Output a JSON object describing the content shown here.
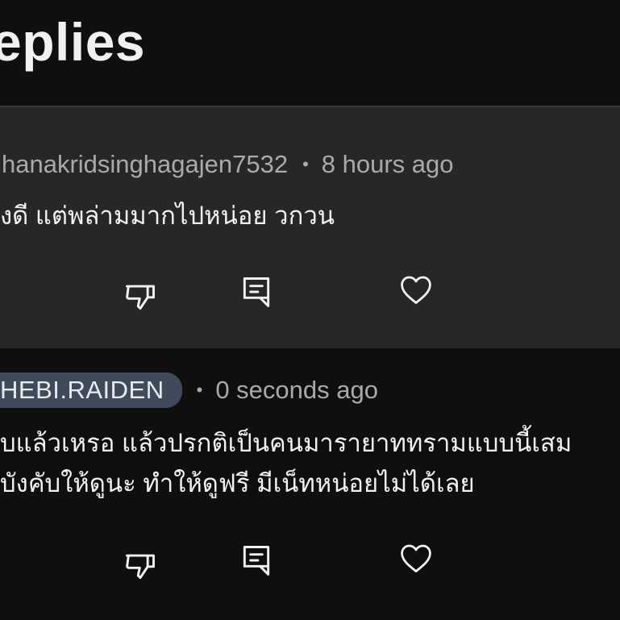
{
  "header": {
    "title": "eplies"
  },
  "comments": [
    {
      "author": "hanakridsinghagajen7532",
      "separator": "•",
      "timestamp": "8 hours ago",
      "lines": [
        "งดี แต่พล่ามมากไปหน่อย วกวน"
      ],
      "highlighted": true,
      "author_badge": false
    },
    {
      "author": "HEBI.RAIDEN",
      "separator": "•",
      "timestamp": "0 seconds ago",
      "lines": [
        "บแล้วเหรอ แล้วปรกติเป็นคนมารายาททรามแบบนี้เสม",
        "บังคับให้ดูนะ ทำให้ดูฟรี มีเน็ทหน่อยไม่ได้เลย"
      ],
      "highlighted": false,
      "author_badge": true
    }
  ],
  "icons": {
    "dislike": "thumbs-down-icon",
    "reply": "reply-comment-icon",
    "like": "heart-icon"
  },
  "colors": {
    "background": "#0f0f0f",
    "highlight": "#272727",
    "badge": "#3f4a5a",
    "text_primary": "#f1f1f1",
    "text_secondary": "#aaaaaa"
  }
}
